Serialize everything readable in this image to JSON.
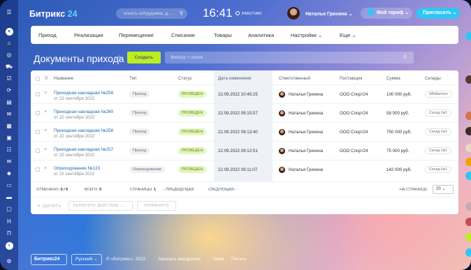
{
  "header": {
    "logo_main": "Битрикс",
    "logo_num": "24",
    "search_placeholder": "искать сотрудника, д...",
    "time": "16:41",
    "work_status": "РАБОТАЮ",
    "user_name": "Наталья Грихина",
    "tariff_label": "Мой тариф",
    "invite_label": "Пригласить"
  },
  "nav": {
    "items": [
      "Приход",
      "Реализация",
      "Перемещение",
      "Списание",
      "Товары",
      "Аналитика",
      "Настройки",
      "Еще"
    ]
  },
  "page": {
    "title": "Документы прихода",
    "create_label": "Создать",
    "filter_placeholder": "Фильтр + поиск"
  },
  "table": {
    "columns": [
      "Название",
      "Тип",
      "Статус",
      "Дата изменения",
      "Ответственный",
      "Поставщик",
      "Сумма",
      "Склады"
    ],
    "rows": [
      {
        "name": "Приходная накладная №259",
        "date": "от 22 сентября 2022",
        "type": "Приход",
        "status": "ПРОВЕДЕН",
        "modified": "22.09.2022 10:45:25",
        "responsible": "Наталья Грихина",
        "supplier": "ООО Спорт24",
        "sum": "100 000 руб.",
        "store": "Wildberries"
      },
      {
        "name": "Приходная накладная №260",
        "date": "от 22 сентября 2022",
        "type": "Приход",
        "status": "ПРОВЕДЕН",
        "modified": "22.09.2022 09:15:07",
        "responsible": "Наталья Грихина",
        "supplier": "ООО Спорт24",
        "sum": "58 000 руб.",
        "store": "Склад №1"
      },
      {
        "name": "Приходная накладная №258",
        "date": "от 22 сентября 2022",
        "type": "Приход",
        "status": "ПРОВЕДЕН",
        "modified": "22.09.2022 09:13:40",
        "responsible": "Наталья Грихина",
        "supplier": "ООО Спорт24",
        "sum": "750 000 руб.",
        "store": "Склад №1"
      },
      {
        "name": "Приходная накладная №257",
        "date": "от 22 сентября 2022",
        "type": "Приход",
        "status": "ПРОВЕДЕН",
        "modified": "22.09.2022 09:12:51",
        "responsible": "Наталья Грихина",
        "supplier": "ООО Спорт24",
        "sum": "75 000 руб.",
        "store": "Склад №1"
      },
      {
        "name": "Оприходование №123",
        "date": "от 22 сентября 2022",
        "type": "Оприходование",
        "status": "ПРОВЕДЕН",
        "modified": "22.09.2022 09:11:07",
        "responsible": "Наталья Грихина",
        "supplier": "",
        "sum": "142 000 руб.",
        "store": "Склад №1"
      }
    ],
    "footer": {
      "selected_label": "ОТМЕЧЕНО:",
      "selected_value": "0 / 5",
      "total_label": "ВСЕГО:",
      "total_value": "5",
      "pages_label": "СТРАНИЦЫ:",
      "pages_value": "1",
      "prev": "‹ ПРЕДЫДУЩАЯ",
      "next": "СЛЕДУЮЩАЯ ›",
      "per_page_label": "НА СТРАНИЦЕ:",
      "per_page_value": "20"
    },
    "actions": {
      "delete": "✕ УДАЛИТЬ",
      "select_action": "ВЫБЕРИТЕ ДЕЙСТВИЕ",
      "apply": "ПРИМЕНИТЬ"
    }
  },
  "bottom": {
    "logo": "Битрикс24",
    "language": "Русский",
    "copyright": "© «Битрикс», 2022",
    "order_link": "Заказать внедрение",
    "themes_link": "Темы",
    "print_link": "Печать"
  },
  "sidebar": {
    "letters": [
      "Н",
      "П"
    ]
  }
}
